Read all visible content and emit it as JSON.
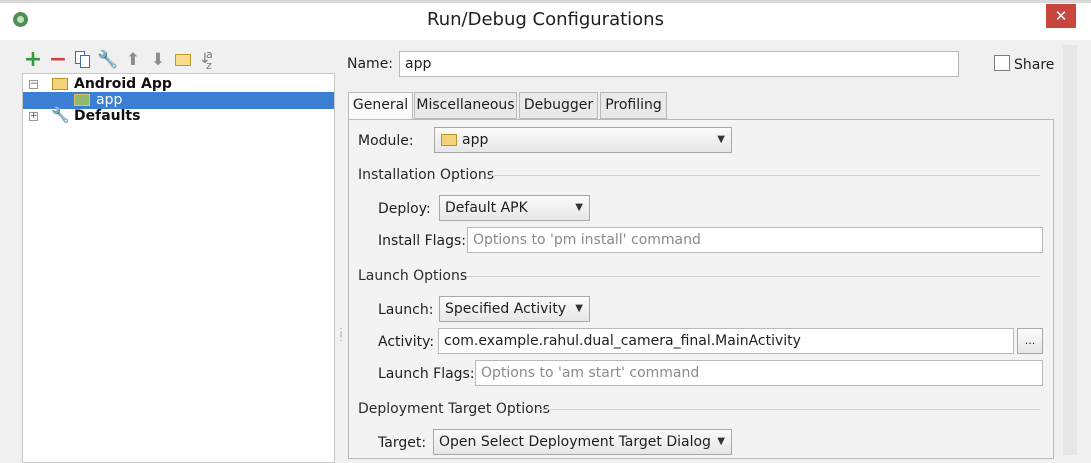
{
  "window": {
    "title": "Run/Debug Configurations",
    "close_glyph": "✕"
  },
  "toolbar": {
    "icons": [
      "add-icon",
      "remove-icon",
      "copy-icon",
      "wrench-icon",
      "arrow-up-icon",
      "arrow-down-icon",
      "folder-icon",
      "sort-icon"
    ],
    "add_glyph": "+",
    "remove_glyph": "−",
    "wrench_glyph": "🔧",
    "up_glyph": "⬆",
    "down_glyph": "⬇",
    "sort_glyph_top": "a",
    "sort_glyph_bottom": "z"
  },
  "tree": {
    "items": [
      {
        "label": "Android App",
        "expander": "−",
        "bold": true
      },
      {
        "label": "app",
        "selected": true
      },
      {
        "label": "Defaults",
        "expander": "+",
        "bold": true
      }
    ]
  },
  "form": {
    "name_label": "Name:",
    "name_value": "app",
    "share_label": "Share",
    "tabs": [
      "General",
      "Miscellaneous",
      "Debugger",
      "Profiling"
    ],
    "module_label": "Module:",
    "module_value": "app",
    "installation_title": "Installation Options",
    "deploy_label": "Deploy:",
    "deploy_value": "Default APK",
    "install_flags_label": "Install Flags:",
    "install_flags_placeholder": "Options to 'pm install' command",
    "launch_title": "Launch Options",
    "launch_label": "Launch:",
    "launch_value": "Specified Activity",
    "activity_label": "Activity:",
    "activity_value": "com.example.rahul.dual_camera_final.MainActivity",
    "browse_label": "...",
    "launch_flags_label": "Launch Flags:",
    "launch_flags_placeholder": "Options to 'am start' command",
    "deployment_title": "Deployment Target Options",
    "target_label": "Target:",
    "target_value": "Open Select Deployment Target Dialog",
    "dropdown_glyph": "▼"
  },
  "colors": {
    "selection": "#3b7fd4",
    "add_green": "#2e9a3a",
    "remove_red": "#c9453b",
    "close_red": "#c8463c"
  }
}
